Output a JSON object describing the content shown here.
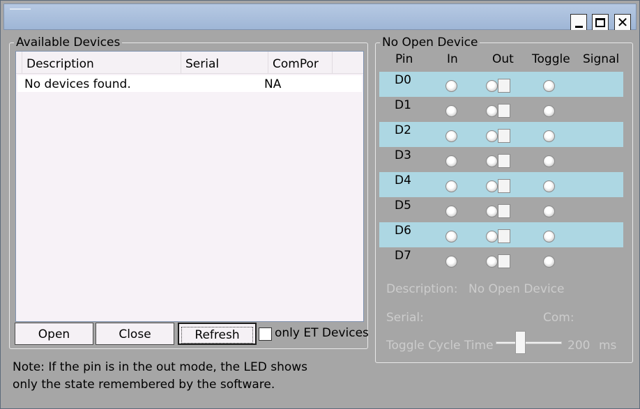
{
  "window": {
    "minimize_label": "_",
    "close_label": "✕"
  },
  "devices": {
    "legend": "Available Devices",
    "columns": [
      "Description",
      "Serial",
      "ComPor"
    ],
    "rows": [
      {
        "description": "No devices found.",
        "serial": "",
        "comport": "NA"
      }
    ],
    "buttons": {
      "open": "Open",
      "close": "Close",
      "refresh": "Refresh"
    },
    "only_et_label": "only ET Devices",
    "only_et_checked": false
  },
  "note": "Note: If the pin is in the out mode, the LED shows only the state remembered by the software.",
  "device_panel": {
    "legend": "No Open Device",
    "headers": {
      "pin": "Pin",
      "in": "In",
      "out": "Out",
      "toggle": "Toggle",
      "signal": "Signal"
    },
    "pins": [
      {
        "name": "D0",
        "highlight": true
      },
      {
        "name": "D1",
        "highlight": false
      },
      {
        "name": "D2",
        "highlight": true
      },
      {
        "name": "D3",
        "highlight": false
      },
      {
        "name": "D4",
        "highlight": true
      },
      {
        "name": "D5",
        "highlight": false
      },
      {
        "name": "D6",
        "highlight": true
      },
      {
        "name": "D7",
        "highlight": false
      }
    ],
    "description_label": "Description:",
    "description_value": "No Open Device",
    "serial_label": "Serial:",
    "com_label": "Com:",
    "toggle_cycle_label": "Toggle Cycle Time",
    "toggle_cycle_value": "200",
    "toggle_cycle_unit": "ms"
  },
  "colors": {
    "highlight_row": "#add7e3",
    "window_bg": "#a6a6a6",
    "disabled_text": "#cccccc"
  }
}
